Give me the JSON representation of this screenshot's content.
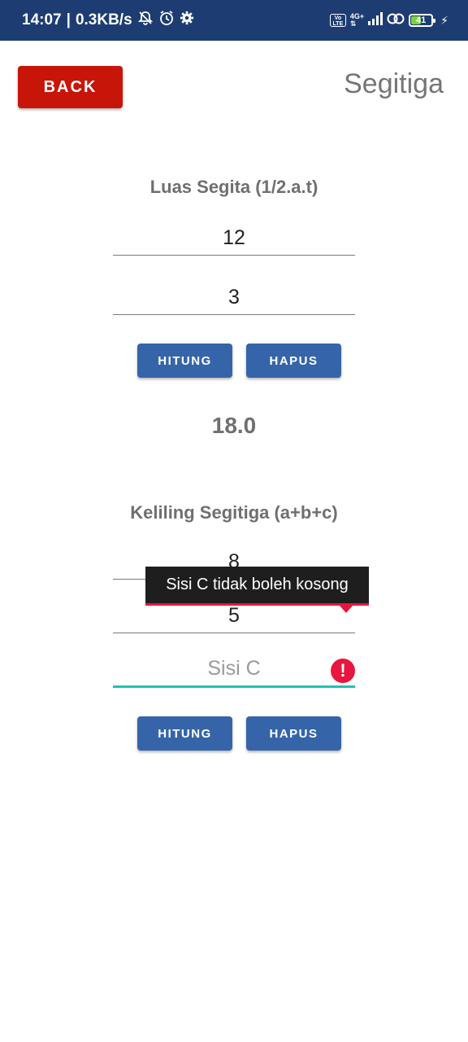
{
  "status_bar": {
    "time": "14:07",
    "speed": "0.3KB/s",
    "volte": "Vo LTE",
    "network": "4G+",
    "battery": "41"
  },
  "header": {
    "back_label": "BACK",
    "title": "Segitiga"
  },
  "luas": {
    "title": "Luas Segita (1/2.a.t)",
    "alas_value": "12",
    "tinggi_value": "3",
    "hitung_label": "HITUNG",
    "hapus_label": "HAPUS",
    "result": "18.0"
  },
  "keliling": {
    "title": "Keliling Segitiga (a+b+c)",
    "sisi_a_value": "8",
    "sisi_b_value": "5",
    "sisi_c_placeholder": "Sisi C",
    "hitung_label": "HITUNG",
    "hapus_label": "HAPUS",
    "error_message": "Sisi C tidak boleh kosong"
  },
  "colors": {
    "status_bar": "#1d3d72",
    "back_button": "#c8150a",
    "action_button": "#3565a8",
    "focus_underline": "#1fc3b0",
    "error": "#e8163f"
  }
}
